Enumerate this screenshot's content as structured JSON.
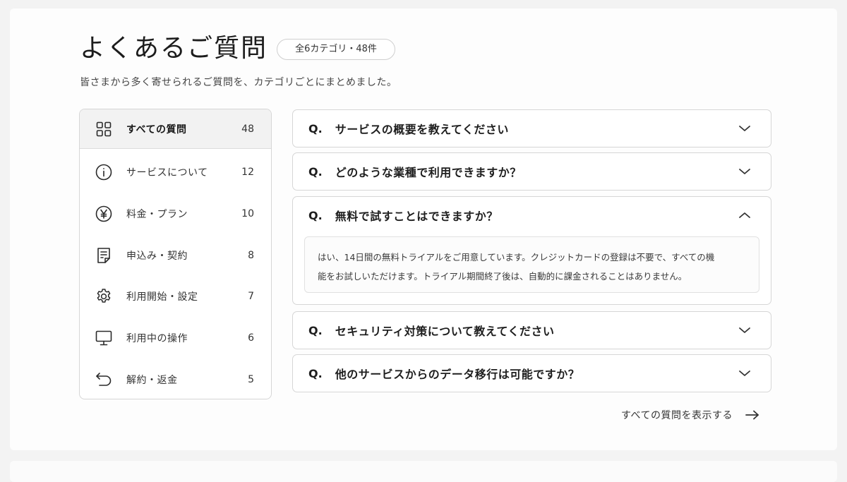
{
  "header": {
    "title": "よくあるご質問",
    "count_pill": "全6カテゴリ・48件",
    "subtitle": "皆さまから多く寄せられるご質問を、カテゴリごとにまとめました。"
  },
  "sidebar": {
    "items": [
      {
        "label": "すべての質問",
        "count": "48",
        "icon": "grid-icon"
      },
      {
        "label": "サービスについて",
        "count": "12",
        "icon": "info-icon"
      },
      {
        "label": "料金・プラン",
        "count": "10",
        "icon": "yen-icon"
      },
      {
        "label": "申込み・契約",
        "count": "8",
        "icon": "document-icon"
      },
      {
        "label": "利用開始・設定",
        "count": "7",
        "icon": "gear-icon"
      },
      {
        "label": "利用中の操作",
        "count": "6",
        "icon": "monitor-icon"
      },
      {
        "label": "解約・返金",
        "count": "5",
        "icon": "undo-icon"
      }
    ]
  },
  "faq": {
    "q_prefix": "Q.",
    "items": [
      {
        "question": "サービスの概要を教えてください",
        "expanded": false
      },
      {
        "question": "どのような業種で利用できますか？",
        "expanded": false
      },
      {
        "question": "無料で試すことはできますか？",
        "expanded": true,
        "answer_line1": "はい、14日間の無料トライアルをご用意しています。クレジットカードの登録は不要で、すべての機",
        "answer_line2": "能をお試しいただけます。トライアル期間終了後は、自動的に課金されることはありません。"
      },
      {
        "question": "セキュリティ対策について教えてください",
        "expanded": false
      },
      {
        "question": "他のサービスからのデータ移行は可能ですか？",
        "expanded": false
      }
    ]
  },
  "footer": {
    "view_all_label": "すべての質問を表示する"
  }
}
